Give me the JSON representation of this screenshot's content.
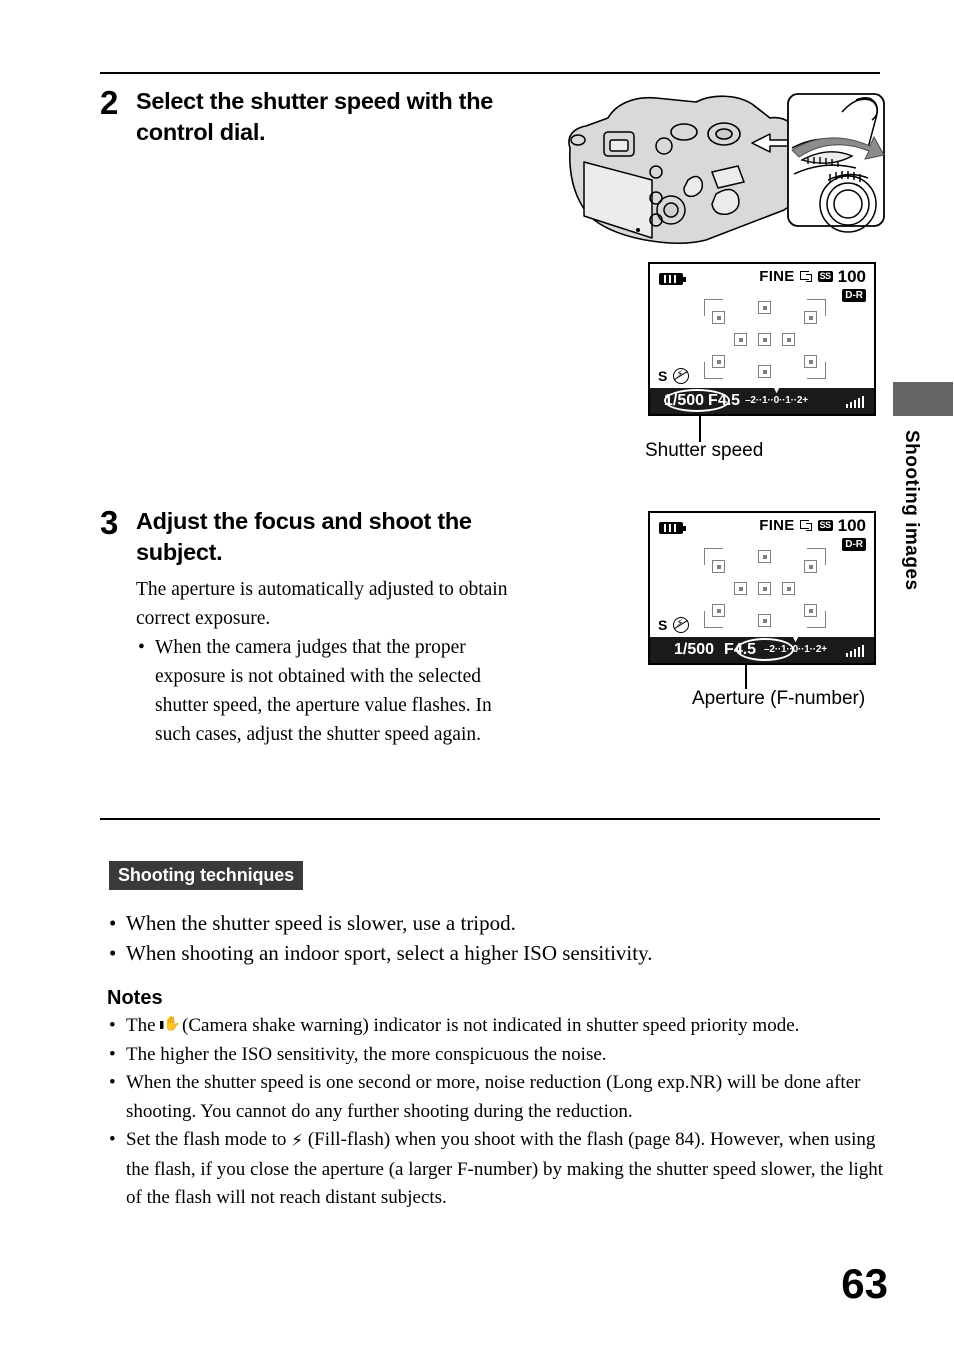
{
  "page": {
    "number": "63",
    "side_tab_label": "Shooting images"
  },
  "steps": [
    {
      "number": "2",
      "heading": "Select the shutter speed with the control dial.",
      "body_paragraph": "",
      "bullets": []
    },
    {
      "number": "3",
      "heading": "Adjust the focus and shoot the subject.",
      "body_paragraph": "The aperture is automatically adjusted to obtain correct exposure.",
      "bullets": [
        "When the camera judges that the proper exposure is not obtained with the selected shutter speed, the aperture value flashes. In such cases, adjust the shutter speed again."
      ]
    }
  ],
  "lcd_top": {
    "quality": "FINE",
    "drive_icon": "drive-mode-icon",
    "steadyshot_icon": "SS",
    "iso": "100",
    "dro": "D-R",
    "battery_icon": "battery-icon",
    "mode": "S",
    "flash_icon": "flash-off-icon",
    "shutter_speed": "1/500",
    "aperture": "F4.5",
    "ev_scale": "–2··1··0··1··2+",
    "ev_marker": "▼",
    "caption": "Shutter speed",
    "highlight": "shutter_speed"
  },
  "lcd_bottom": {
    "quality": "FINE",
    "drive_icon": "drive-mode-icon",
    "steadyshot_icon": "SS",
    "iso": "100",
    "dro": "D-R",
    "battery_icon": "battery-icon",
    "mode": "S",
    "flash_icon": "flash-off-icon",
    "shutter_speed": "1/500",
    "aperture": "F4.5",
    "ev_scale": "–2··1··0··1··2+",
    "ev_marker": "▼",
    "caption": "Aperture (F-number)",
    "highlight": "aperture"
  },
  "shooting_techniques": {
    "badge": "Shooting techniques",
    "bullets": [
      "When the shutter speed is slower, use a tripod.",
      "When shooting an indoor sport, select a higher ISO sensitivity."
    ]
  },
  "notes": {
    "heading": "Notes",
    "items": [
      {
        "prefix": "The ",
        "icon": "camera-shake-warning-icon",
        "suffix": " (Camera shake warning) indicator is not indicated in shutter speed priority mode."
      },
      {
        "prefix": "The higher the ISO sensitivity, the more conspicuous the noise.",
        "icon": "",
        "suffix": ""
      },
      {
        "prefix": "When the shutter speed is one second or more, noise reduction (Long exp.NR) will be done after shooting. You cannot do any further shooting during the reduction.",
        "icon": "",
        "suffix": ""
      },
      {
        "prefix": "Set the flash mode to ",
        "icon": "fill-flash-icon",
        "suffix": " (Fill-flash) when you shoot with the flash (page 84). However, when using the flash, if you close the aperture (a larger F-number) by making the shutter speed slower, the light of the flash will not reach distant subjects."
      }
    ]
  },
  "colors": {
    "tab_gray": "#646464",
    "badge_dark": "#3a3a3a",
    "lcd_bar": "#1a1a1a",
    "af_gray": "#808080"
  }
}
